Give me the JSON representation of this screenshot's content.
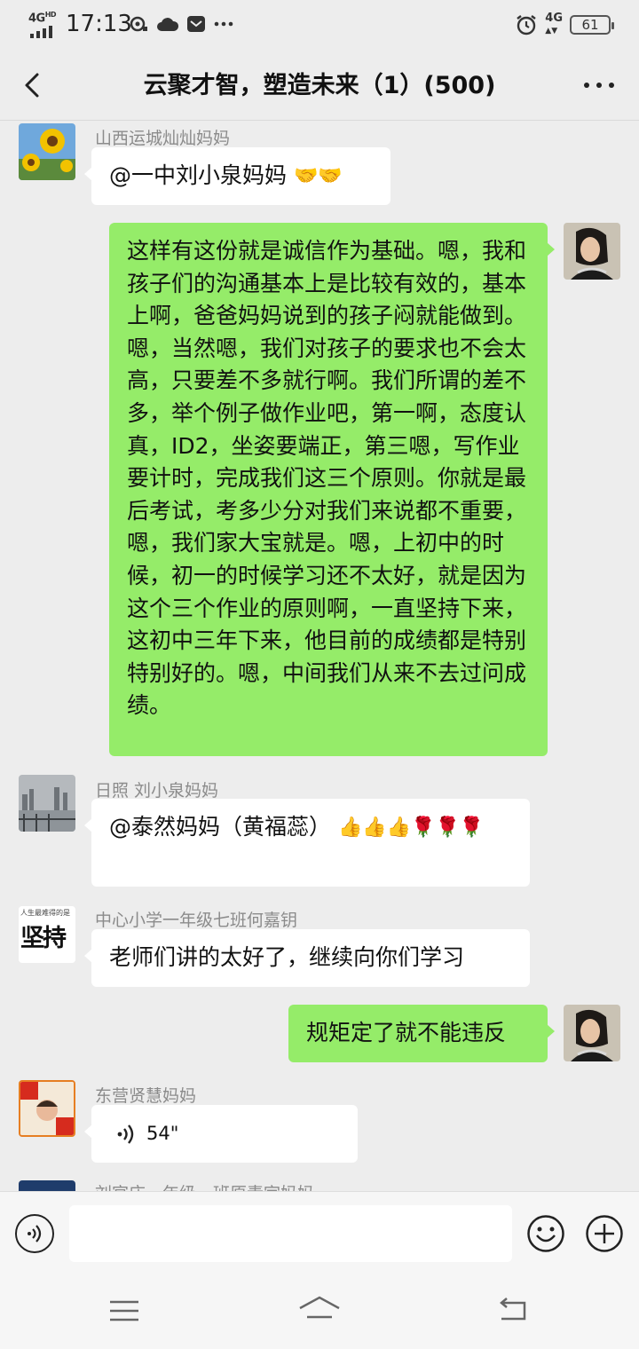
{
  "status_bar": {
    "network": "4G",
    "network_sup": "HD",
    "time": "17:13",
    "right_network": "4G",
    "battery": "61",
    "icons": [
      "hotspot-icon",
      "weather-cloud-icon",
      "message-icon",
      "more-dots-icon",
      "alarm-icon"
    ]
  },
  "header": {
    "title": "云聚才智，塑造未来（1）(500)"
  },
  "messages": [
    {
      "sender": "山西运城灿灿妈妈",
      "text": "@一中刘小泉妈妈 ",
      "emoji": "🤝🤝",
      "side": "left"
    },
    {
      "sender": "",
      "text": "这样有这份就是诚信作为基础。嗯，我和孩子们的沟通基本上是比较有效的，基本上啊，爸爸妈妈说到的孩子闷就能做到。嗯，当然嗯，我们对孩子的要求也不会太高，只要差不多就行啊。我们所谓的差不多，举个例子做作业吧，第一啊，态度认真，ID2，坐姿要端正，第三嗯，写作业要计时，完成我们这三个原则。你就是最后考试，考多少分对我们来说都不重要，嗯，我们家大宝就是。嗯，上初中的时候，初一的时候学习还不太好，就是因为这个三个作业的原则啊，一直坚持下来，这初中三年下来，他目前的成绩都是特别特别好的。嗯，中间我们从来不去过问成绩。",
      "side": "right"
    },
    {
      "sender": "日照  刘小泉妈妈",
      "text": "@泰然妈妈（黄福蕊） ",
      "emoji": "👍👍👍🌹🌹🌹",
      "side": "left"
    },
    {
      "sender": "中心小学一年级七班何嘉钥",
      "text": "老师们讲的太好了，继续向你们学习",
      "avatar_text": "坚持",
      "avatar_caption": "人生最难得的是",
      "side": "left"
    },
    {
      "sender": "",
      "text": "规矩定了就不能违反",
      "side": "right"
    },
    {
      "sender": "东营贤慧妈妈",
      "voice_duration": "54\"",
      "side": "left"
    },
    {
      "sender": "刘官庄一年级一班原素宇妈妈",
      "side": "left"
    }
  ],
  "input": {
    "placeholder": ""
  },
  "colors": {
    "background": "#ededed",
    "bubble_self": "#95ec69",
    "bubble_other": "#ffffff"
  }
}
